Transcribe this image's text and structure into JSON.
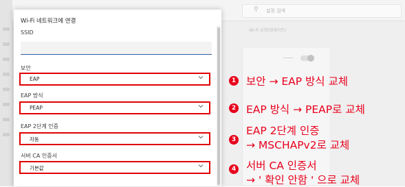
{
  "dialog": {
    "title": "Wi-Fi 네트워크에 연결",
    "ssid": {
      "label": "SSID",
      "value": ""
    },
    "security": {
      "label": "보안",
      "value": "EAP"
    },
    "eap_method": {
      "label": "EAP 방식",
      "value": "PEAP"
    },
    "phase2": {
      "label": "EAP 2단계 인증",
      "value": "자동"
    },
    "ca_cert": {
      "label": "서버 CA 인증서",
      "value": "기본값"
    }
  },
  "background": {
    "search_placeholder": "설정 검색",
    "subtitle": "Wi-Fi 유형(업데이트)"
  },
  "annotations": [
    {
      "number": "1",
      "line1": "보안 → EAP 방식 교체",
      "line2": ""
    },
    {
      "number": "2",
      "line1": "EAP 방식 → PEAP로 교체",
      "line2": ""
    },
    {
      "number": "3",
      "line1": "EAP 2단계 인증",
      "line2": "→ MSCHAPv2로 교체"
    },
    {
      "number": "4",
      "line1": "서버 CA 인증서",
      "line2": "→ ' 확인 안함 ' 으로 교체"
    }
  ],
  "colors": {
    "highlight": "#e00000",
    "annotation": "#e8001c",
    "accent": "#2f5fa8"
  }
}
